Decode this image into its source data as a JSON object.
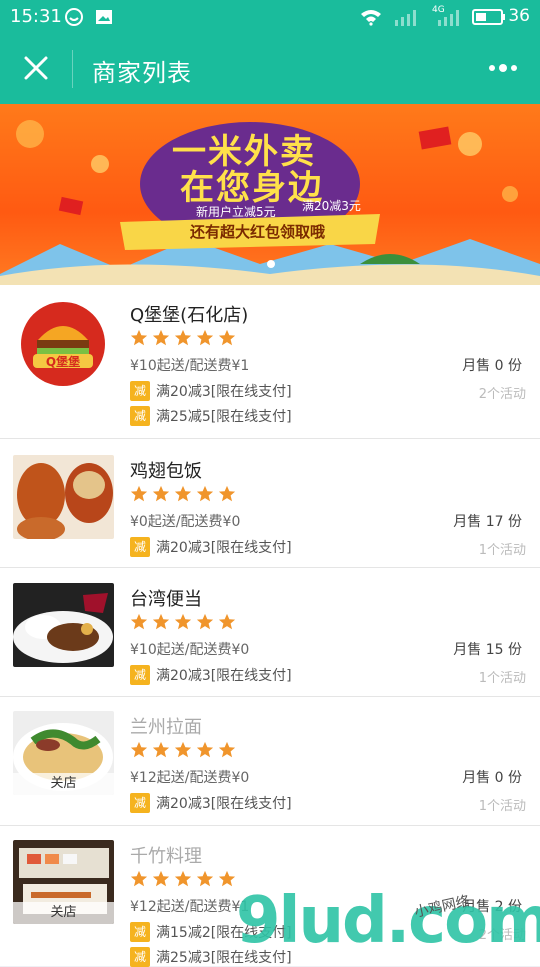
{
  "status_bar": {
    "time": "15:31",
    "battery": "36",
    "network": "4G"
  },
  "app_bar": {
    "title": "商家列表"
  },
  "banner": {
    "headline_1": "一米外卖",
    "headline_2": "在您身边",
    "promo_1": "新用户立减5元",
    "promo_2": "满20减3元",
    "ribbon": "还有超大红包领取哦"
  },
  "restaurants": [
    {
      "name": "Q堡堡(石化店)",
      "min_fee": "¥10起送/配送费¥1",
      "monthly_sales": "月售 0 份",
      "promos": [
        "满20减3[限在线支付]",
        "满25减5[限在线支付]"
      ],
      "activity_count": "2个活动",
      "closed": false,
      "closed_label": "",
      "badge": "减",
      "rating": 5,
      "logo_text": "Q堡堡"
    },
    {
      "name": "鸡翅包饭",
      "min_fee": "¥0起送/配送费¥0",
      "monthly_sales": "月售 17 份",
      "promos": [
        "满20减3[限在线支付]"
      ],
      "activity_count": "1个活动",
      "closed": false,
      "closed_label": "",
      "badge": "减",
      "rating": 5
    },
    {
      "name": "台湾便当",
      "min_fee": "¥10起送/配送费¥0",
      "monthly_sales": "月售 15 份",
      "promos": [
        "满20减3[限在线支付]"
      ],
      "activity_count": "1个活动",
      "closed": false,
      "closed_label": "",
      "badge": "减",
      "rating": 5
    },
    {
      "name": "兰州拉面",
      "min_fee": "¥12起送/配送费¥0",
      "monthly_sales": "月售 0 份",
      "promos": [
        "满20减3[限在线支付]"
      ],
      "activity_count": "1个活动",
      "closed": true,
      "closed_label": "关店",
      "badge": "减",
      "rating": 5
    },
    {
      "name": "千竹料理",
      "min_fee": "¥12起送/配送费¥1",
      "monthly_sales": "月售 2 份",
      "promos": [
        "满15减2[限在线支付]",
        "满25减3[限在线支付]"
      ],
      "activity_count": "2个活动",
      "closed": true,
      "closed_label": "关店",
      "badge": "减",
      "rating": 5
    }
  ],
  "watermark": {
    "text": "9lud.com",
    "sub": "小鸡网络"
  },
  "colors": {
    "primary": "#1abc9c",
    "star": "#f0952c",
    "promo_badge": "#f5b31f"
  }
}
